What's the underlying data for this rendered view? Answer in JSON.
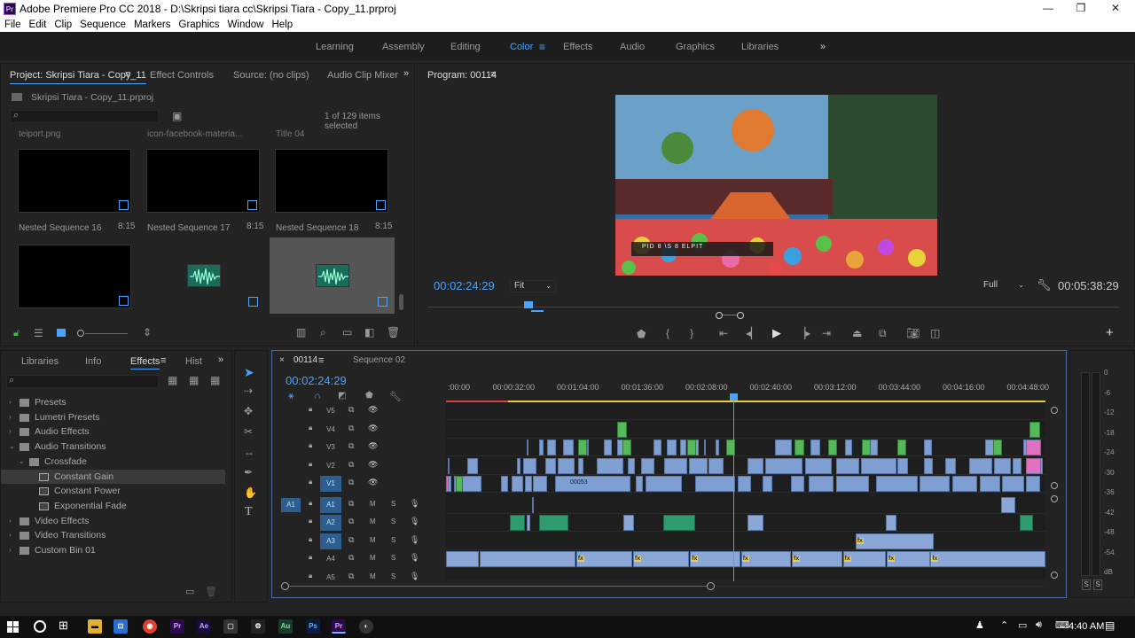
{
  "window": {
    "title": "Adobe Premiere Pro CC 2018 - D:\\Skripsi tiara cc\\Skripsi Tiara - Copy_11.prproj",
    "minimize": "—",
    "maximize": "❐",
    "close": "✕"
  },
  "menu": [
    "File",
    "Edit",
    "Clip",
    "Sequence",
    "Markers",
    "Graphics",
    "Window",
    "Help"
  ],
  "workspaces": {
    "items": [
      "Learning",
      "Assembly",
      "Editing",
      "Color",
      "Effects",
      "Audio",
      "Graphics",
      "Libraries"
    ],
    "active": "Color",
    "more": "»"
  },
  "project_panel": {
    "tabs": [
      "Project: Skripsi Tiara - Copy_11",
      "Effect Controls",
      "Source: (no clips)",
      "Audio Clip Mixer"
    ],
    "project_file": "Skripsi Tiara - Copy_11.prproj",
    "selection_count": "1 of 129 items selected",
    "partial_labels": [
      "teiport.png",
      "icon-facebook-materia...",
      "Title 04"
    ],
    "items": [
      {
        "name": "Nested Sequence 16",
        "duration": "8:15"
      },
      {
        "name": "Nested Sequence 17",
        "duration": "8:15"
      },
      {
        "name": "Nested Sequence 18",
        "duration": "8:15"
      }
    ]
  },
  "program_monitor": {
    "tab": "Program: 00114",
    "timecode": "00:02:24:29",
    "fit": "Fit",
    "quality": "Full",
    "duration": "00:05:38:29",
    "overlay_text": "PID 8 \\S  8 ELPIT",
    "add": "+"
  },
  "effects_panel": {
    "tabs": [
      "Libraries",
      "Info",
      "Effects",
      "Hist"
    ],
    "active_tab": "Effects",
    "tree": [
      {
        "label": "Presets",
        "level": 0,
        "expanded": false,
        "kind": "folder"
      },
      {
        "label": "Lumetri Presets",
        "level": 0,
        "expanded": false,
        "kind": "folder"
      },
      {
        "label": "Audio Effects",
        "level": 0,
        "expanded": false,
        "kind": "folder"
      },
      {
        "label": "Audio Transitions",
        "level": 0,
        "expanded": true,
        "kind": "folder"
      },
      {
        "label": "Crossfade",
        "level": 1,
        "expanded": true,
        "kind": "folder"
      },
      {
        "label": "Constant Gain",
        "level": 2,
        "expanded": false,
        "kind": "effect",
        "selected": true
      },
      {
        "label": "Constant Power",
        "level": 2,
        "expanded": false,
        "kind": "effect"
      },
      {
        "label": "Exponential Fade",
        "level": 2,
        "expanded": false,
        "kind": "effect"
      },
      {
        "label": "Video Effects",
        "level": 0,
        "expanded": false,
        "kind": "folder"
      },
      {
        "label": "Video Transitions",
        "level": 0,
        "expanded": false,
        "kind": "folder"
      },
      {
        "label": "Custom Bin 01",
        "level": 0,
        "expanded": false,
        "kind": "folder"
      }
    ]
  },
  "timeline": {
    "tabs": [
      "00114",
      "Sequence 02"
    ],
    "timecode": "00:02:24:29",
    "ruler": [
      ":00:00",
      "00:00:32:00",
      "00:01:04:00",
      "00:01:36:00",
      "00:02:08:00",
      "00:02:40:00",
      "00:03:12:00",
      "00:03:44:00",
      "00:04:16:00",
      "00:04:48:00"
    ],
    "video_tracks": [
      "V5",
      "V4",
      "V3",
      "V2",
      "V1"
    ],
    "audio_tracks": [
      "A1",
      "A2",
      "A3",
      "A4",
      "A5"
    ],
    "source_patch": "A1",
    "clip_label": "00053",
    "mute": "M",
    "solo": "S",
    "playhead_pct": 48
  },
  "audio_meter": {
    "scale": [
      "0",
      "-6",
      "-12",
      "-18",
      "-24",
      "-30",
      "-36",
      "-42",
      "-48",
      "-54",
      "dB"
    ],
    "solo": [
      "S",
      "S"
    ]
  },
  "taskbar": {
    "time": "4:40 AM"
  },
  "colors": {
    "accent": "#4aa3ff",
    "video_clip": "#7f9ed2",
    "green_clip": "#55b85a",
    "audio_clip": "#2f9c6e",
    "pink_clip": "#e070c0"
  }
}
